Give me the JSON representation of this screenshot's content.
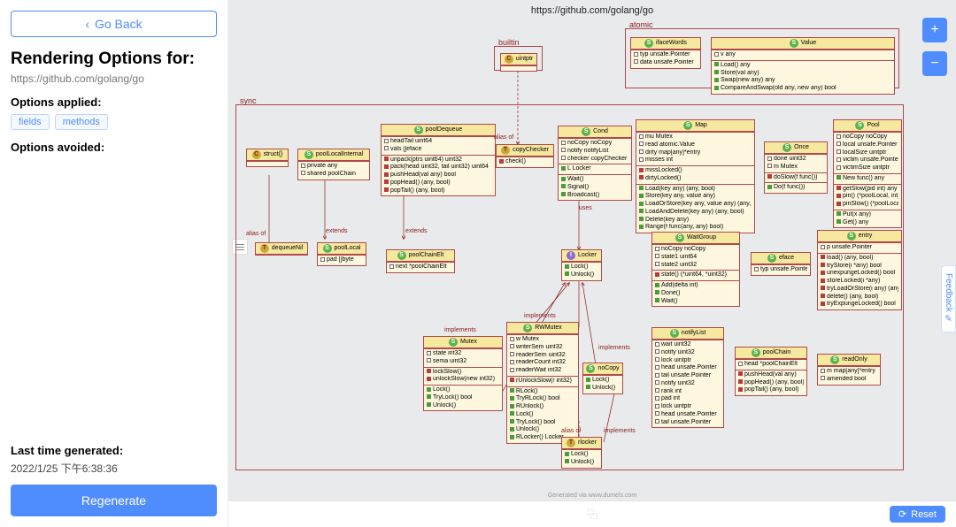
{
  "sidebar": {
    "go_back": "Go Back",
    "heading": "Rendering Options for:",
    "url": "https://github.com/golang/go",
    "options_applied_label": "Options applied:",
    "tags": [
      "fields",
      "methods"
    ],
    "options_avoided_label": "Options avoided:",
    "last_time_label": "Last time generated:",
    "last_time": "2022/1/25 下午6:38:36",
    "regenerate": "Regenerate"
  },
  "canvas": {
    "title": "https://github.com/golang/go",
    "generated_note": "Generated via www.dumels.com",
    "reset": "Reset",
    "feedback": "Feedback",
    "plus": "+",
    "minus": "−"
  },
  "packages": {
    "atomic": "atomic",
    "builtin": "builtin",
    "sync": "sync"
  },
  "annotations": {
    "alias_of": "alias of",
    "extends": "extends",
    "implements": "implements",
    "uses": "uses"
  },
  "classes": {
    "ifaceWords": {
      "title": "ifaceWords",
      "icon": "S",
      "fields": [
        "typ unsafe.Pointer",
        "data unsafe.Pointer"
      ]
    },
    "Value": {
      "title": "Value",
      "icon": "S",
      "fields": [
        "v any"
      ],
      "methods_g": [
        "Load() any",
        "Store(val any)",
        "Swap(new any) any",
        "CompareAndSwap(old any, new any) bool"
      ]
    },
    "uintptr": {
      "title": "uintptr",
      "icon": "C"
    },
    "struct": {
      "title": "struct{}",
      "icon": "C"
    },
    "poolLocalInternal": {
      "title": "poolLocalInternal",
      "icon": "S",
      "fields": [
        "private any",
        "shared poolChain"
      ]
    },
    "poolDequeue": {
      "title": "poolDequeue",
      "icon": "S",
      "fields": [
        "headTail uint64",
        "vals []eface"
      ],
      "methods_r": [
        "unpack(ptrs uint64) uint32",
        "pack(head uint32, tail uint32) uint64",
        "pushHead(val any) bool",
        "popHead() (any, bool)",
        "popTail() (any, bool)"
      ]
    },
    "copyChecker": {
      "title": "copyChecker",
      "icon": "T",
      "methods_r": [
        "check()"
      ]
    },
    "Cond": {
      "title": "Cond",
      "icon": "S",
      "fields": [
        "noCopy noCopy",
        "notify notifyList",
        "checker copyChecker"
      ],
      "fields_g": [
        "L Locker"
      ],
      "methods_g": [
        "Wait()",
        "Signal()",
        "Broadcast()"
      ]
    },
    "Map": {
      "title": "Map",
      "icon": "S",
      "fields": [
        "mu Mutex",
        "read atomic.Value",
        "dirty map[any]*entry",
        "misses int"
      ],
      "methods_r": [
        "missLocked()",
        "dirtyLocked()"
      ],
      "methods_g": [
        "Load(key any) (any, bool)",
        "Store(key any, value any)",
        "LoadOrStore(key any, value any) (any, bool)",
        "LoadAndDelete(key any) (any, bool)",
        "Delete(key any)",
        "Range(f func(any, any) bool)"
      ]
    },
    "Once": {
      "title": "Once",
      "icon": "S",
      "fields": [
        "done uint32",
        "m Mutex"
      ],
      "methods_r": [
        "doSlow(f func())"
      ],
      "methods_g": [
        "Do(f func())"
      ]
    },
    "Pool": {
      "title": "Pool",
      "icon": "S",
      "fields": [
        "noCopy noCopy",
        "local unsafe.Pointer",
        "localSize uintptr",
        "victim unsafe.Pointer",
        "victimSize uintptr"
      ],
      "fields_g": [
        "New func() any"
      ],
      "methods_r": [
        "getSlow(pid int) any",
        "pin() (*poolLocal, int)",
        "pinSlow() (*poolLocal, int)"
      ],
      "methods_g": [
        "Put(x any)",
        "Get() any"
      ]
    },
    "dequeueNil": {
      "title": "dequeueNil",
      "icon": "T"
    },
    "poolLocal": {
      "title": "poolLocal",
      "icon": "S",
      "fields": [
        "pad []byte"
      ]
    },
    "poolChainElt": {
      "title": "poolChainElt",
      "icon": "S",
      "fields": [
        "next *poolChainElt"
      ]
    },
    "Locker": {
      "title": "Locker",
      "icon": "I",
      "methods_g": [
        "Lock()",
        "Unlock()"
      ]
    },
    "WaitGroup": {
      "title": "WaitGroup",
      "icon": "S",
      "fields": [
        "noCopy noCopy",
        "state1 uint64",
        "state2 uint32"
      ],
      "methods_r": [
        "state() (*uint64, *uint32)"
      ],
      "methods_g": [
        "Add(delta int)",
        "Done()",
        "Wait()"
      ]
    },
    "eface": {
      "title": "eface",
      "icon": "S",
      "fields": [
        "typ unsafe.Pointer"
      ]
    },
    "entry": {
      "title": "entry",
      "icon": "S",
      "fields": [
        "p unsafe.Pointer"
      ],
      "methods_r": [
        "load() (any, bool)",
        "tryStore(i *any) bool",
        "unexpungeLocked() bool",
        "storeLocked(i *any)",
        "tryLoadOrStore(i any) (any, bool)",
        "delete() (any, bool)",
        "tryExpungeLocked() bool"
      ]
    },
    "Mutex": {
      "title": "Mutex",
      "icon": "S",
      "fields": [
        "state int32",
        "sema uint32"
      ],
      "methods_r": [
        "lockSlow()",
        "unlockSlow(new int32)"
      ],
      "methods_g": [
        "Lock()",
        "TryLock() bool",
        "Unlock()"
      ]
    },
    "RWMutex": {
      "title": "RWMutex",
      "icon": "S",
      "fields": [
        "w Mutex",
        "writerSem uint32",
        "readerSem uint32",
        "readerCount int32",
        "readerWait int32"
      ],
      "methods_r": [
        "rUnlockSlow(r int32)"
      ],
      "methods_g": [
        "RLock()",
        "TryRLock() bool",
        "RUnlock()",
        "Lock()",
        "TryLock() bool",
        "Unlock()",
        "RLocker() Locker"
      ]
    },
    "noCopy": {
      "title": "noCopy",
      "icon": "S",
      "methods_g": [
        "Lock()",
        "Unlock()"
      ]
    },
    "notifyList": {
      "title": "notifyList",
      "icon": "S",
      "fields": [
        "wait uint32",
        "notify uint32",
        "lock uintptr",
        "head unsafe.Pointer",
        "tail unsafe.Pointer",
        "notify uint32",
        "rank int",
        "pad int",
        "lock uintptr",
        "head unsafe.Pointer",
        "tail unsafe.Pointer"
      ]
    },
    "poolChain": {
      "title": "poolChain",
      "icon": "S",
      "fields": [
        "head *poolChainElt"
      ],
      "methods_r": [
        "pushHead(val any)",
        "popHead() (any, bool)",
        "popTail() (any, bool)"
      ]
    },
    "readOnly": {
      "title": "readOnly",
      "icon": "S",
      "fields": [
        "m map[any]*entry",
        "amended bool"
      ]
    },
    "rlocker": {
      "title": "rlocker",
      "icon": "T",
      "methods_g": [
        "Lock()",
        "Unlock()"
      ]
    }
  }
}
